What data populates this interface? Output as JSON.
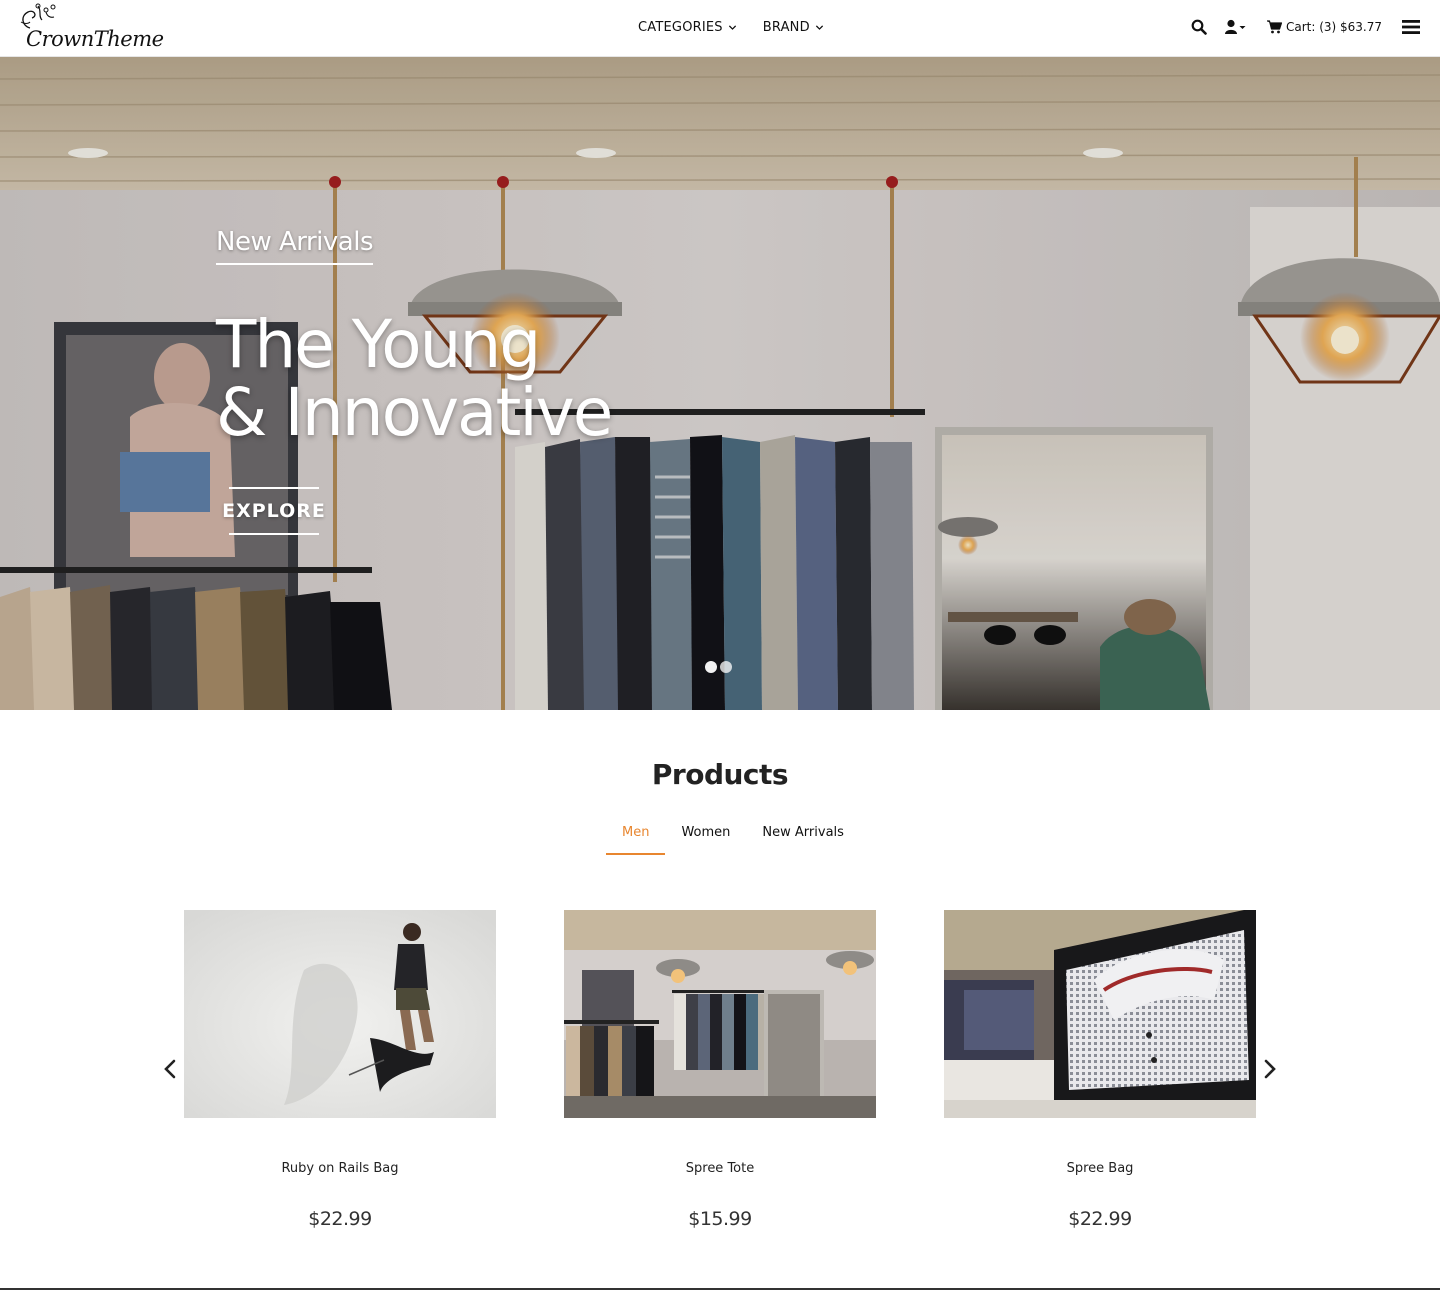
{
  "brand": {
    "name": "CrownTheme"
  },
  "nav": {
    "items": [
      {
        "label": "CATEGORIES"
      },
      {
        "label": "BRAND"
      }
    ]
  },
  "header": {
    "cart_label": "Cart: (3) $63.77",
    "icons": [
      "search-icon",
      "user-icon",
      "cart-icon",
      "menu-icon"
    ]
  },
  "hero": {
    "subtitle": "New Arrivals",
    "title_line1": "The Young",
    "title_line2": "& Innovative",
    "button_label": "EXPLORE",
    "slide_count": 2,
    "active_slide": 1
  },
  "products": {
    "title": "Products",
    "tabs": [
      {
        "label": "Men",
        "active": true
      },
      {
        "label": "Women",
        "active": false
      },
      {
        "label": "New Arrivals",
        "active": false
      }
    ],
    "items": [
      {
        "name": "Ruby on Rails Bag",
        "price": "$22.99"
      },
      {
        "name": "Spree Tote",
        "price": "$15.99"
      },
      {
        "name": "Spree Bag",
        "price": "$22.99"
      }
    ]
  },
  "colors": {
    "accent": "#e8862f",
    "text": "#222222",
    "background": "#ffffff"
  }
}
